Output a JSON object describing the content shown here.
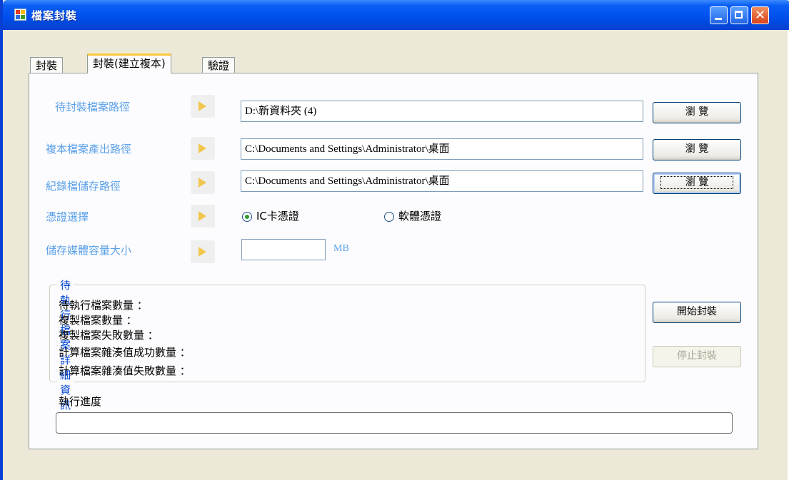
{
  "window": {
    "title": "檔案封裝"
  },
  "tabs": [
    {
      "label": "封裝",
      "active": false
    },
    {
      "label": "封裝(建立複本)",
      "active": true
    },
    {
      "label": "驗證",
      "active": false
    }
  ],
  "fields": {
    "source": {
      "label": "待封裝檔案路徑",
      "value": "D:\\新資料夾 (4)",
      "browse": "瀏 覽"
    },
    "copy_output": {
      "label": "複本檔案產出路徑",
      "value": "C:\\Documents and Settings\\Administrator\\桌面",
      "browse": "瀏 覽"
    },
    "log_path": {
      "label": "紀錄檔儲存路徑",
      "value": "C:\\Documents and Settings\\Administrator\\桌面",
      "browse": "瀏 覽"
    },
    "credential": {
      "label": "憑證選擇",
      "options": [
        "IC卡憑證",
        "軟體憑證"
      ],
      "selected": "IC卡憑證"
    },
    "media_size": {
      "label": "儲存媒體容量大小",
      "value": "",
      "unit": "MB"
    }
  },
  "details": {
    "title": "待執行檔案詳細資訊",
    "lines": [
      "待執行檔案數量 ：",
      "複製檔案數量 ：",
      "複製檔案失敗數量 ：",
      "計算檔案雜湊值成功數量 ：",
      "計算檔案雜湊值失敗數量 ："
    ]
  },
  "actions": {
    "start": "開始封裝",
    "stop": "停止封裝"
  },
  "progress": {
    "label": "執行進度",
    "value": 0
  },
  "colors": {
    "titlebar": "#0050ee",
    "label_blue": "#5aa0e8",
    "group_title": "#0046d5",
    "dialog_bg": "#ece9d8"
  }
}
